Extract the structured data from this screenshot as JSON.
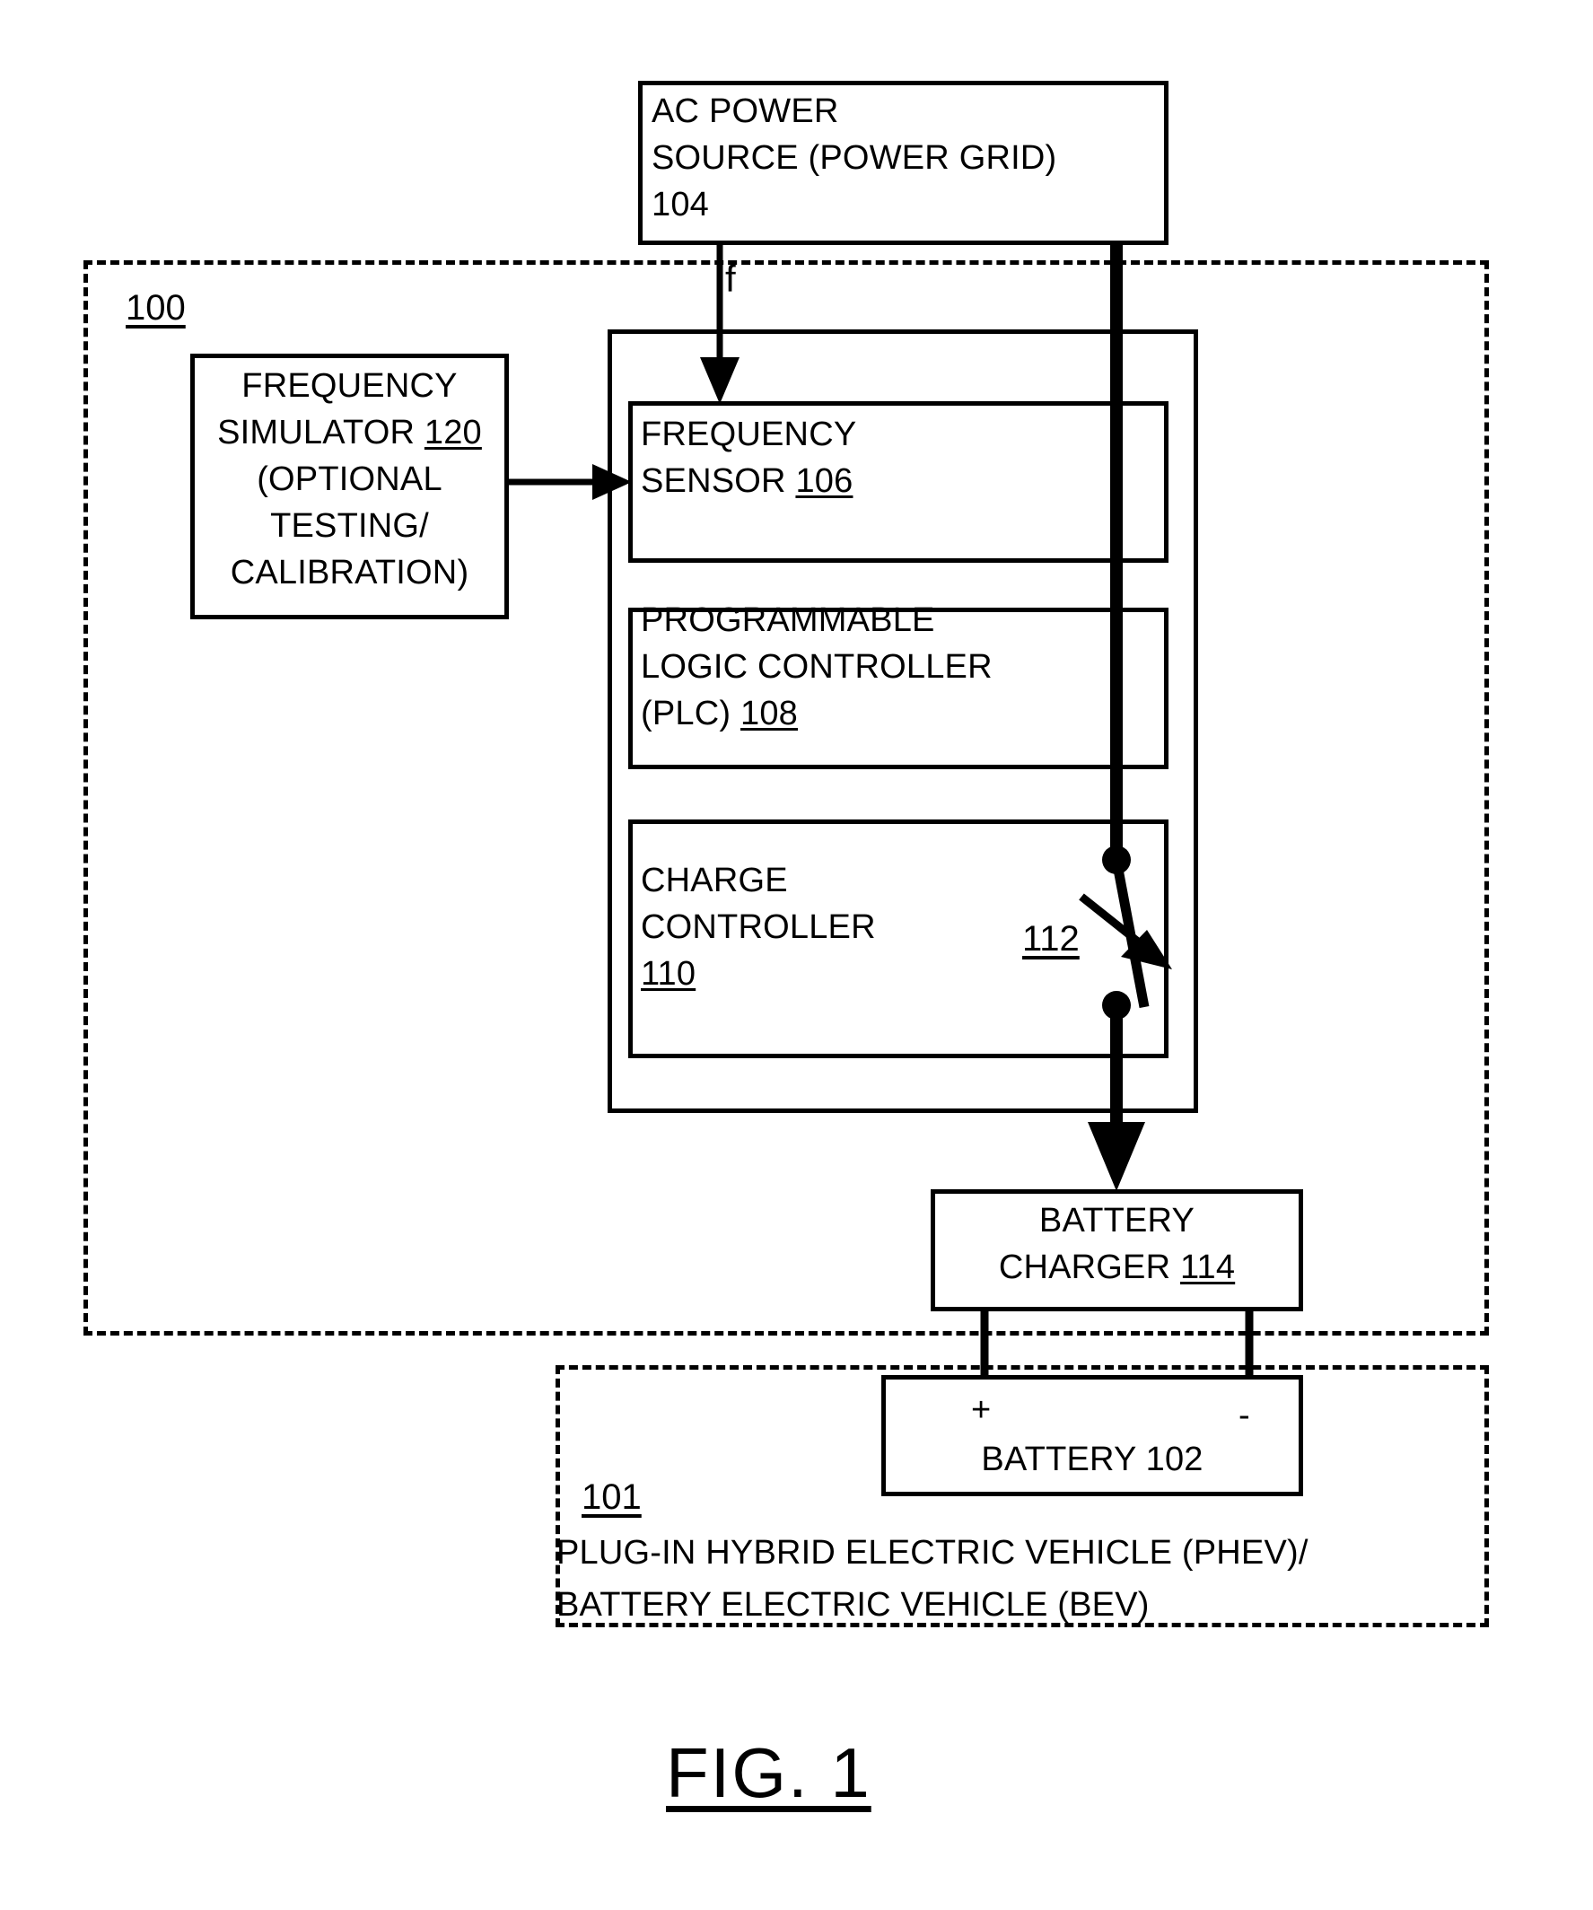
{
  "figure": {
    "caption": "FIG. 1",
    "system_ref": "100",
    "vehicle_ref": "101",
    "signal_label": "f"
  },
  "blocks": {
    "ac_power_source": {
      "line1": "AC POWER",
      "line2": "SOURCE (POWER GRID)",
      "ref": "104"
    },
    "frequency_simulator": {
      "line1": "FREQUENCY",
      "line2_prefix": "SIMULATOR ",
      "ref": "120",
      "line3": "(OPTIONAL",
      "line4": "TESTING/",
      "line5": "CALIBRATION)"
    },
    "frequency_sensor": {
      "line1": "FREQUENCY",
      "line2_prefix": "SENSOR ",
      "ref": "106"
    },
    "plc": {
      "line1": "PROGRAMMABLE",
      "line2": "LOGIC CONTROLLER",
      "line3_prefix": "(PLC) ",
      "ref": "108"
    },
    "charge_controller": {
      "line1": "CHARGE",
      "line2": "CONTROLLER",
      "ref": "110"
    },
    "switch": {
      "ref": "112"
    },
    "battery_charger": {
      "line1": "BATTERY",
      "line2_prefix": "CHARGER ",
      "ref": "114"
    },
    "battery": {
      "label": "BATTERY 102",
      "positive_terminal": "+",
      "negative_terminal": "-"
    },
    "vehicle_enclosure": {
      "line1": "PLUG-IN HYBRID ELECTRIC VEHICLE (PHEV)/",
      "line2": "BATTERY ELECTRIC VEHICLE (BEV)"
    }
  },
  "colors": {
    "stroke": "#000000",
    "background": "#ffffff"
  }
}
